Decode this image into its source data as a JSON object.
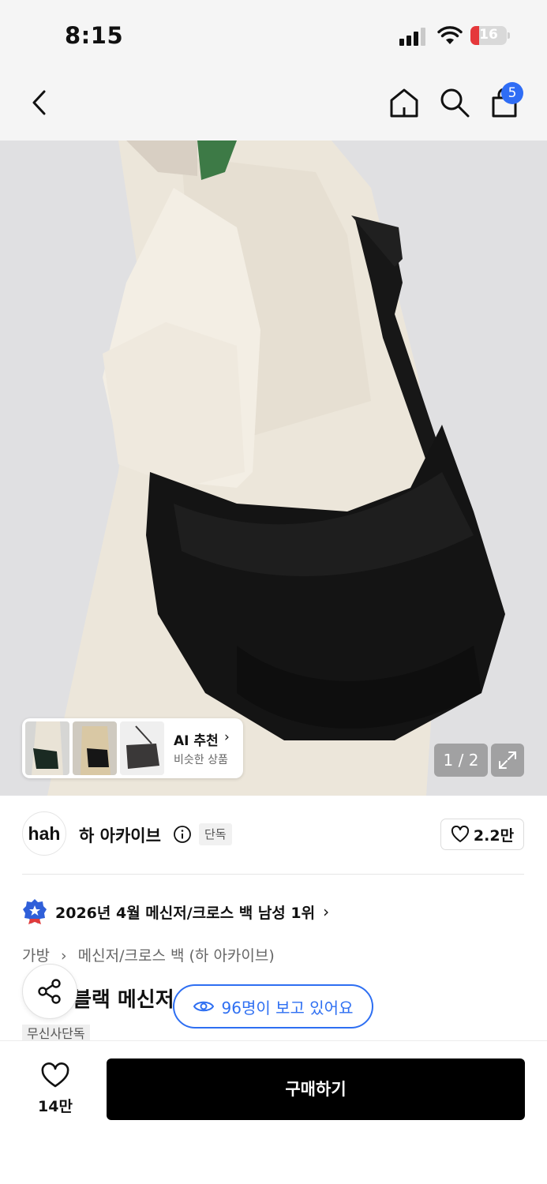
{
  "status_bar": {
    "time": "8:15",
    "battery": "16"
  },
  "nav": {
    "cart_count": "5"
  },
  "gallery": {
    "ai_title": "AI 추천",
    "ai_subtitle": "비슷한 상품",
    "counter": "1 / 2"
  },
  "brand": {
    "logo_text": "hah",
    "name": "하 아카이브",
    "tag": "단독",
    "likes": "2.2만"
  },
  "ranking": {
    "text": "2026년 4월 메신저/크로스 백 남성 1위"
  },
  "breadcrumb": {
    "items": [
      "가방",
      "메신저/크로스 백 (하 아카이브)"
    ]
  },
  "product": {
    "title": "블랙 메신저 백",
    "viewers": "96명이 보고 있어요",
    "tag": "무신사단독"
  },
  "bottom": {
    "like_count": "14만",
    "buy_label": "구매하기"
  },
  "colors": {
    "accent_blue": "#2e6ff2",
    "buy_button": "#000000",
    "badge_blue": "#2f6df5"
  },
  "icons": [
    "back-icon",
    "home-icon",
    "search-icon",
    "cart-icon",
    "expand-icon",
    "info-icon",
    "heart-icon",
    "ranking-badge-icon",
    "share-icon",
    "eye-icon"
  ]
}
